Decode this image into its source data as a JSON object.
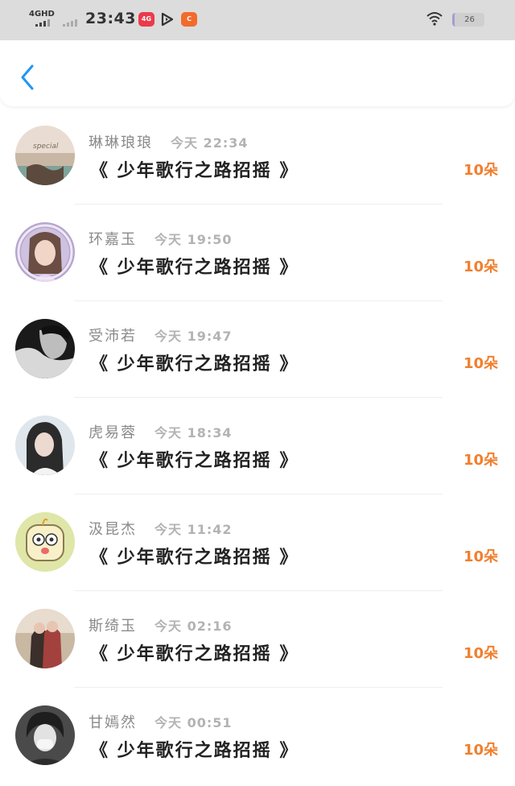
{
  "status_bar": {
    "network": "4GHD",
    "time": "23:43",
    "battery": "26",
    "app_badge_1": "4G",
    "app_badge_2": "C",
    "colors": {
      "app1": "#e93b4b",
      "app3": "#f26b2c",
      "accent_battery": "#a99bd1"
    }
  },
  "nav": {
    "back_icon": "chevron-left-icon",
    "accent": "#2196f3"
  },
  "colors": {
    "gift_count": "#f07f2e",
    "name": "#8a8a8a",
    "time": "#b3b3b3",
    "title": "#222222"
  },
  "messages": [
    {
      "name": "琳琳琅琅",
      "time": "今天 22:34",
      "title": "《 少年歌行之路招摇 》",
      "count": "10朵"
    },
    {
      "name": "环嘉玉",
      "time": "今天 19:50",
      "title": "《 少年歌行之路招摇 》",
      "count": "10朵"
    },
    {
      "name": "受沛若",
      "time": "今天 19:47",
      "title": "《 少年歌行之路招摇 》",
      "count": "10朵"
    },
    {
      "name": "虎易蓉",
      "time": "今天 18:34",
      "title": "《 少年歌行之路招摇 》",
      "count": "10朵"
    },
    {
      "name": "汲昆杰",
      "time": "今天 11:42",
      "title": "《 少年歌行之路招摇 》",
      "count": "10朵"
    },
    {
      "name": "斯绮玉",
      "time": "今天 02:16",
      "title": "《 少年歌行之路招摇 》",
      "count": "10朵"
    },
    {
      "name": "甘嫣然",
      "time": "今天 00:51",
      "title": "《 少年歌行之路招摇 》",
      "count": "10朵"
    }
  ]
}
